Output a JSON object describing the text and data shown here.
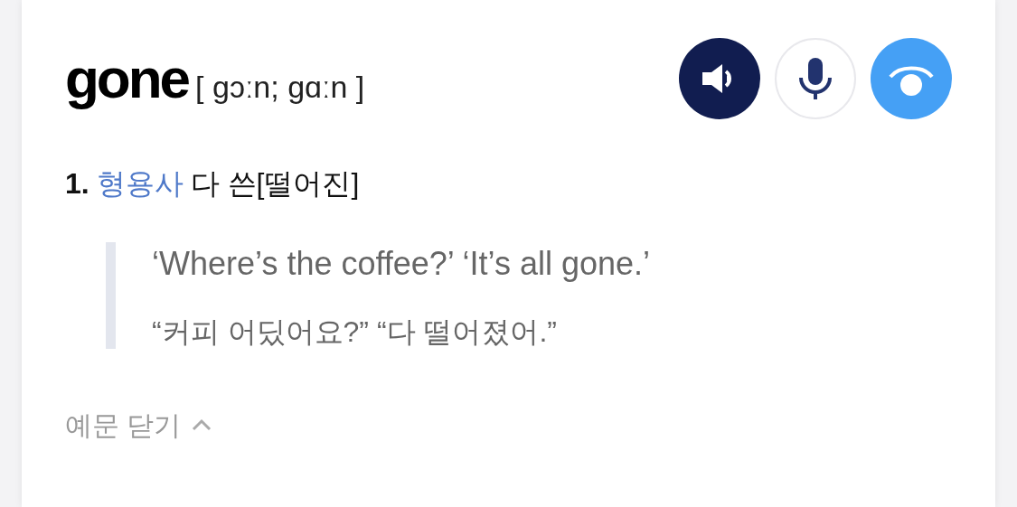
{
  "entry": {
    "word": "gone",
    "pronunciation": "[ gɔːn; gɑːn ]"
  },
  "buttons": [
    {
      "kind": "speaker"
    },
    {
      "kind": "mic"
    },
    {
      "kind": "record"
    }
  ],
  "senses": [
    {
      "number": "1.",
      "part_of_speech": "형용사",
      "meaning": "다 쓴[떨어진]",
      "examples": [
        {
          "text": "‘Where’s the coffee?’ ‘It’s all gone.’",
          "translation": "“커피 어딨어요?” “다 떨어졌어.”"
        }
      ]
    }
  ],
  "examples_toggle": {
    "label": "예문 닫기",
    "expanded": true
  }
}
